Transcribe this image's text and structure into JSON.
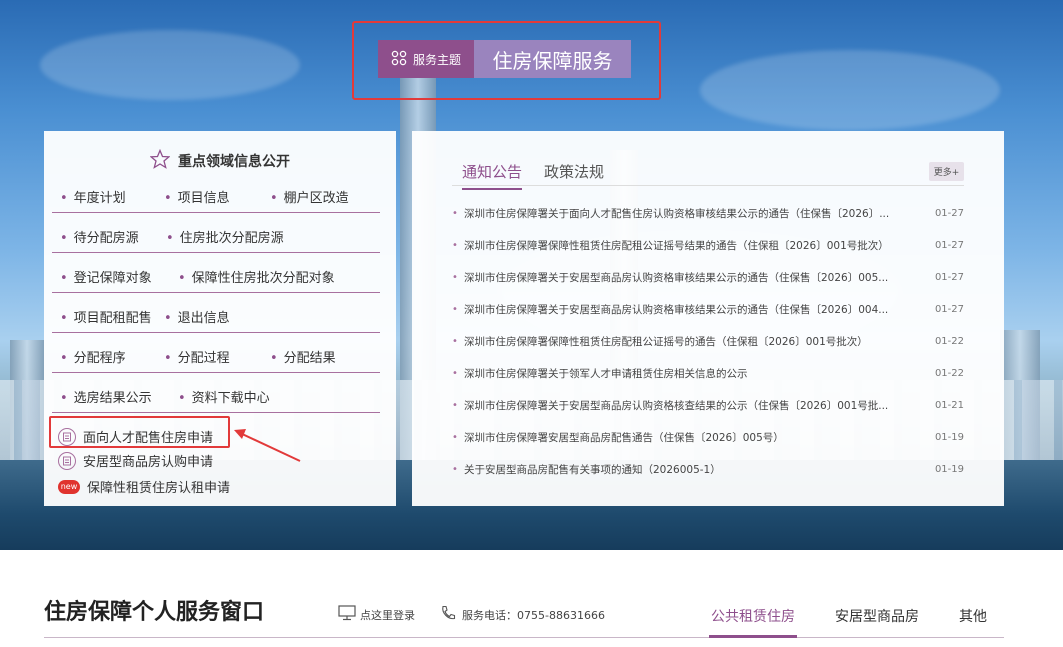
{
  "banner": {
    "tag_label": "服务主题",
    "title": "住房保障服务"
  },
  "left_panel": {
    "title": "重点领域信息公开",
    "rows": [
      [
        "年度计划",
        "项目信息",
        "棚户区改造"
      ],
      [
        "待分配房源",
        "住房批次分配房源"
      ],
      [
        "登记保障对象",
        "保障性住房批次分配对象"
      ],
      [
        "项目配租配售",
        "退出信息"
      ],
      [
        "分配程序",
        "分配过程",
        "分配结果"
      ],
      [
        "选房结果公示",
        "资料下载中心"
      ]
    ],
    "applications": [
      {
        "label": "面向人才配售住房申请",
        "icon": "apply-icon"
      },
      {
        "label": "安居型商品房认购申请",
        "icon": "apply-icon"
      },
      {
        "label": "保障性租赁住房认租申请",
        "icon": "new-badge",
        "badge": "new"
      }
    ]
  },
  "news_panel": {
    "tabs": [
      "通知公告",
      "政策法规"
    ],
    "active_tab": 0,
    "more_label": "更多+",
    "items": [
      {
        "title": "深圳市住房保障署关于面向人才配售住房认购资格审核结果公示的通告（住保售〔2026〕...",
        "date": "01-27"
      },
      {
        "title": "深圳市住房保障署保障性租赁住房配租公证摇号结果的通告（住保租〔2026〕001号批次）",
        "date": "01-27"
      },
      {
        "title": "深圳市住房保障署关于安居型商品房认购资格审核结果公示的通告（住保售〔2026〕005...",
        "date": "01-27"
      },
      {
        "title": "深圳市住房保障署关于安居型商品房认购资格审核结果公示的通告（住保售〔2026〕004...",
        "date": "01-27"
      },
      {
        "title": "深圳市住房保障署保障性租赁住房配租公证摇号的通告（住保租〔2026〕001号批次）",
        "date": "01-22"
      },
      {
        "title": "深圳市住房保障署关于领军人才申请租赁住房相关信息的公示",
        "date": "01-22"
      },
      {
        "title": "深圳市住房保障署关于安居型商品房认购资格核查结果的公示（住保售〔2026〕001号批...",
        "date": "01-21"
      },
      {
        "title": "深圳市住房保障署安居型商品房配售通告（住保售〔2026〕005号）",
        "date": "01-19"
      },
      {
        "title": "关于安居型商品房配售有关事项的通知（2026005-1）",
        "date": "01-19"
      }
    ]
  },
  "service_window": {
    "title": "住房保障个人服务窗口",
    "login_label": "点这里登录",
    "phone_label": "服务电话：0755-88631666",
    "tabs": [
      "公共租赁住房",
      "安居型商品房",
      "其他"
    ],
    "active_tab": 0
  },
  "colors": {
    "accent": "#8e4f8c",
    "accent_light": "#9a84be",
    "highlight": "#e23a3a"
  }
}
